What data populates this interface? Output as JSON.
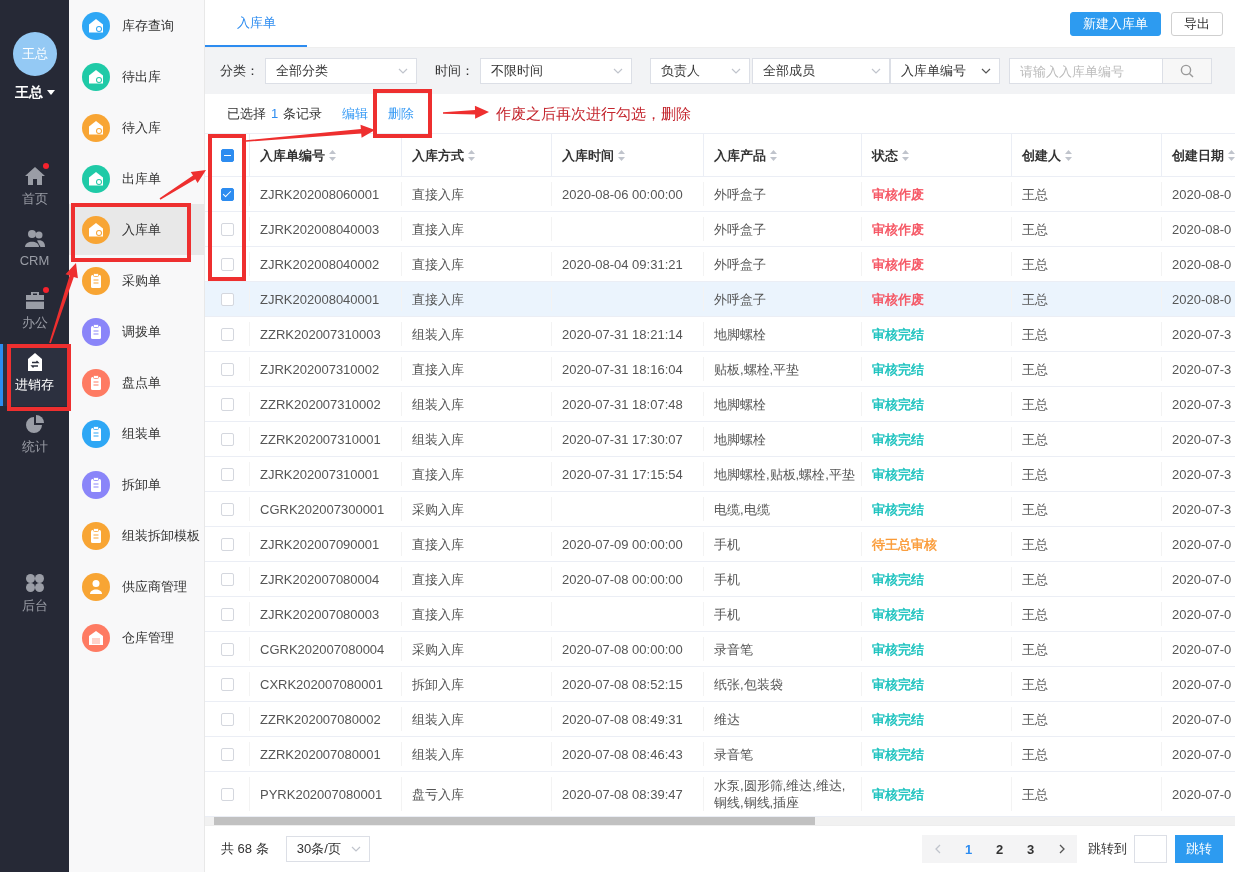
{
  "user": {
    "avatar_text": "王总",
    "name": "王总"
  },
  "nav_groups": [
    {
      "items": [
        {
          "label": "首页",
          "badge": true,
          "selected": false
        },
        {
          "label": "CRM",
          "badge": false,
          "selected": false
        },
        {
          "label": "办公",
          "badge": true,
          "selected": false
        },
        {
          "label": "进销存",
          "badge": false,
          "selected": true
        },
        {
          "label": "统计",
          "badge": false,
          "selected": false
        }
      ]
    },
    {
      "items": [
        {
          "label": "后台",
          "badge": false,
          "selected": false
        }
      ]
    }
  ],
  "sidebar": {
    "items": [
      {
        "label": "库存查询",
        "color": "#2ea7f5",
        "selected": false
      },
      {
        "label": "待出库",
        "color": "#1fcaa7",
        "selected": false
      },
      {
        "label": "待入库",
        "color": "#f8a534",
        "selected": false
      },
      {
        "label": "出库单",
        "color": "#1fcaa7",
        "selected": false
      },
      {
        "label": "入库单",
        "color": "#f8a534",
        "selected": true
      },
      {
        "label": "采购单",
        "color": "#f8a534",
        "selected": false
      },
      {
        "label": "调拨单",
        "color": "#8a85f9",
        "selected": false
      },
      {
        "label": "盘点单",
        "color": "#fe7b63",
        "selected": false
      },
      {
        "label": "组装单",
        "color": "#2ea7f5",
        "selected": false
      },
      {
        "label": "拆卸单",
        "color": "#8a85f9",
        "selected": false
      },
      {
        "label": "组装拆卸模板",
        "color": "#f8a534",
        "selected": false
      },
      {
        "label": "供应商管理",
        "color": "#f8a534",
        "selected": false
      },
      {
        "label": "仓库管理",
        "color": "#fe7b63",
        "selected": false
      }
    ]
  },
  "tabs": [
    {
      "label": "入库单",
      "selected": true
    }
  ],
  "toolbar_buttons": [
    {
      "label": "新建入库单",
      "kind": "primary"
    },
    {
      "label": "导出",
      "kind": "default"
    }
  ],
  "filters": {
    "category": {
      "label": "分类：",
      "value": "全部分类"
    },
    "time": {
      "label": "时间：",
      "value": "不限时间"
    },
    "owner": {
      "field": "负责人",
      "value": "全部成员"
    },
    "number": {
      "field": "入库单编号",
      "placeholder": "请输入入库单编号"
    }
  },
  "selection": {
    "prefix": "已选择",
    "count": "1",
    "suffix": "条记录"
  },
  "actions": [
    "编辑",
    "删除"
  ],
  "annotation": "作废之后再次进行勾选，删除",
  "table": {
    "select_all": {
      "indeterminate": true
    },
    "columns": [
      "入库单编号",
      "入库方式",
      "入库时间",
      "入库产品",
      "状态",
      "创建人",
      "创建日期"
    ],
    "rows": [
      {
        "checked": true,
        "highlighted": false,
        "number": "ZJRK202008060001",
        "method": "直接入库",
        "time": "2020-08-06 00:00:00",
        "product": "外呼盒子",
        "status": {
          "text": "审核作废",
          "color": "#f5515f"
        },
        "creator": "王总",
        "created_date": "2020-08-0"
      },
      {
        "checked": false,
        "highlighted": false,
        "number": "ZJRK202008040003",
        "method": "直接入库",
        "product": "外呼盒子",
        "status": {
          "text": "审核作废",
          "color": "#f5515f"
        },
        "creator": "王总",
        "created_date": "2020-08-0"
      },
      {
        "checked": false,
        "highlighted": false,
        "number": "ZJRK202008040002",
        "method": "直接入库",
        "time": "2020-08-04 09:31:21",
        "product": "外呼盒子",
        "status": {
          "text": "审核作废",
          "color": "#f5515f"
        },
        "creator": "王总",
        "created_date": "2020-08-0"
      },
      {
        "checked": false,
        "highlighted": true,
        "number": "ZJRK202008040001",
        "method": "直接入库",
        "product": "外呼盒子",
        "status": {
          "text": "审核作废",
          "color": "#f5515f"
        },
        "creator": "王总",
        "created_date": "2020-08-0"
      },
      {
        "checked": false,
        "highlighted": false,
        "number": "ZZRK202007310003",
        "method": "组装入库",
        "time": "2020-07-31 18:21:14",
        "product": "地脚螺栓",
        "status": {
          "text": "审核完结",
          "color": "#17c1bd"
        },
        "creator": "王总",
        "created_date": "2020-07-3"
      },
      {
        "checked": false,
        "highlighted": false,
        "number": "ZJRK202007310002",
        "method": "直接入库",
        "time": "2020-07-31 18:16:04",
        "product": "贴板,螺栓,平垫",
        "status": {
          "text": "审核完结",
          "color": "#17c1bd"
        },
        "creator": "王总",
        "created_date": "2020-07-3"
      },
      {
        "checked": false,
        "highlighted": false,
        "number": "ZZRK202007310002",
        "method": "组装入库",
        "time": "2020-07-31 18:07:48",
        "product": "地脚螺栓",
        "status": {
          "text": "审核完结",
          "color": "#17c1bd"
        },
        "creator": "王总",
        "created_date": "2020-07-3"
      },
      {
        "checked": false,
        "highlighted": false,
        "number": "ZZRK202007310001",
        "method": "组装入库",
        "time": "2020-07-31 17:30:07",
        "product": "地脚螺栓",
        "status": {
          "text": "审核完结",
          "color": "#17c1bd"
        },
        "creator": "王总",
        "created_date": "2020-07-3"
      },
      {
        "checked": false,
        "highlighted": false,
        "number": "ZJRK202007310001",
        "method": "直接入库",
        "time": "2020-07-31 17:15:54",
        "product": "地脚螺栓,贴板,螺栓,平垫",
        "status": {
          "text": "审核完结",
          "color": "#17c1bd"
        },
        "creator": "王总",
        "created_date": "2020-07-3"
      },
      {
        "checked": false,
        "highlighted": false,
        "number": "CGRK202007300001",
        "method": "采购入库",
        "product": "电缆,电缆",
        "status": {
          "text": "审核完结",
          "color": "#17c1bd"
        },
        "creator": "王总",
        "created_date": "2020-07-3"
      },
      {
        "checked": false,
        "highlighted": false,
        "number": "ZJRK202007090001",
        "method": "直接入库",
        "time": "2020-07-09 00:00:00",
        "product": "手机",
        "status": {
          "text": "待王总审核",
          "color": "#fa9a36"
        },
        "creator": "王总",
        "created_date": "2020-07-0"
      },
      {
        "checked": false,
        "highlighted": false,
        "number": "ZJRK202007080004",
        "method": "直接入库",
        "time": "2020-07-08 00:00:00",
        "product": "手机",
        "status": {
          "text": "审核完结",
          "color": "#17c1bd"
        },
        "creator": "王总",
        "created_date": "2020-07-0"
      },
      {
        "checked": false,
        "highlighted": false,
        "number": "ZJRK202007080003",
        "method": "直接入库",
        "product": "手机",
        "status": {
          "text": "审核完结",
          "color": "#17c1bd"
        },
        "creator": "王总",
        "created_date": "2020-07-0"
      },
      {
        "checked": false,
        "highlighted": false,
        "number": "CGRK202007080004",
        "method": "采购入库",
        "time": "2020-07-08 00:00:00",
        "product": "录音笔",
        "status": {
          "text": "审核完结",
          "color": "#17c1bd"
        },
        "creator": "王总",
        "created_date": "2020-07-0"
      },
      {
        "checked": false,
        "highlighted": false,
        "number": "CXRK202007080001",
        "method": "拆卸入库",
        "time": "2020-07-08 08:52:15",
        "product": "纸张,包装袋",
        "status": {
          "text": "审核完结",
          "color": "#17c1bd"
        },
        "creator": "王总",
        "created_date": "2020-07-0"
      },
      {
        "checked": false,
        "highlighted": false,
        "number": "ZZRK202007080002",
        "method": "组装入库",
        "time": "2020-07-08 08:49:31",
        "product": "维达",
        "status": {
          "text": "审核完结",
          "color": "#17c1bd"
        },
        "creator": "王总",
        "created_date": "2020-07-0"
      },
      {
        "checked": false,
        "highlighted": false,
        "number": "ZZRK202007080001",
        "method": "组装入库",
        "time": "2020-07-08 08:46:43",
        "product": "录音笔",
        "status": {
          "text": "审核完结",
          "color": "#17c1bd"
        },
        "creator": "王总",
        "created_date": "2020-07-0"
      },
      {
        "checked": false,
        "highlighted": false,
        "number": "PYRK202007080001",
        "method": "盘亏入库",
        "time": "2020-07-08 08:39:47",
        "product": "水泵,圆形筛,维达,维达,铜线,铜线,插座",
        "status": {
          "text": "审核完结",
          "color": "#17c1bd"
        },
        "creator": "王总",
        "created_date": "2020-07-0"
      }
    ]
  },
  "pagination": {
    "total": "共 68 条",
    "page_size": "30条/页",
    "prev": {
      "disabled": true
    },
    "pages": [
      {
        "label": "1",
        "selected": true
      },
      {
        "label": "2",
        "selected": false
      },
      {
        "label": "3",
        "selected": false
      }
    ],
    "next": {
      "disabled": false
    },
    "jump_label": "跳转到",
    "jump_button": "跳转"
  }
}
